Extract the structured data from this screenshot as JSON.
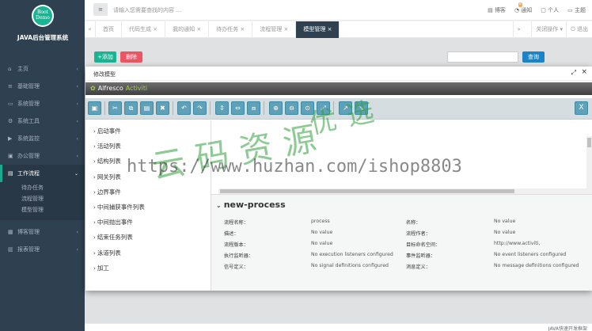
{
  "sidebar": {
    "logo_line1": "Boot",
    "logo_line2": "Demo",
    "app_title": "JAVA后台管理系统",
    "items": [
      {
        "icon": "home-icon",
        "glyph": "⌂",
        "label": "主页",
        "arrow": "‹"
      },
      {
        "icon": "list-icon",
        "glyph": "≡",
        "label": "基础管理",
        "arrow": "‹"
      },
      {
        "icon": "monitor-icon",
        "glyph": "▭",
        "label": "系统管理",
        "arrow": "‹"
      },
      {
        "icon": "gear-icon",
        "glyph": "⚙",
        "label": "系统工具",
        "arrow": "‹"
      },
      {
        "icon": "video-icon",
        "glyph": "▶",
        "label": "系统监控",
        "arrow": "‹"
      },
      {
        "icon": "briefcase-icon",
        "glyph": "▣",
        "label": "办公管理",
        "arrow": "‹"
      }
    ],
    "active_item": {
      "icon": "workflow-icon",
      "glyph": "▤",
      "label": "工作流程",
      "arrow": "⌄"
    },
    "sub_items": [
      "待办任务",
      "流程管理",
      "模型管理"
    ],
    "bottom_items": [
      {
        "icon": "blog-icon",
        "glyph": "▦",
        "label": "博客管理",
        "arrow": "‹"
      },
      {
        "icon": "report-icon",
        "glyph": "▥",
        "label": "报表管理",
        "arrow": "‹"
      }
    ]
  },
  "topbar": {
    "menu_glyph": "≡",
    "search_placeholder": "请输入您需要查找的内容 …",
    "right_items": [
      {
        "icon": "blog-icon",
        "glyph": "▤",
        "label": "博客"
      },
      {
        "icon": "bell-icon",
        "glyph": "🔔",
        "label": "通知",
        "badge": "8"
      },
      {
        "icon": "user-icon",
        "glyph": "▢",
        "label": "个人"
      },
      {
        "icon": "theme-icon",
        "glyph": "▭",
        "label": "主题"
      }
    ]
  },
  "tabs": {
    "prev": "«",
    "items": [
      "首页",
      "代码生成 ×",
      "我的通知 ×",
      "待办任务 ×",
      "流程管理 ×",
      "模型管理 ×"
    ],
    "active_index": 5,
    "next": "»",
    "ops": "关闭操作 ▾",
    "exit": "⏻ 退出"
  },
  "content": {
    "add_label": "+添加",
    "delete_label": "删除",
    "query_label": "查询"
  },
  "footer": {
    "text": "JAVA快速开发框架"
  },
  "modal": {
    "title": "修改模型",
    "max_glyph": "⤢",
    "close_glyph": "×",
    "brand1": "Alfresco",
    "brand2": "Activiti",
    "toolbar_icons": [
      {
        "name": "save-icon",
        "glyph": "▣"
      },
      {
        "name": "cut-icon",
        "glyph": "✂"
      },
      {
        "name": "copy-icon",
        "glyph": "⧉"
      },
      {
        "name": "paste-icon",
        "glyph": "▤"
      },
      {
        "name": "delete-icon",
        "glyph": "✖"
      },
      {
        "name": "undo-icon",
        "glyph": "↶"
      },
      {
        "name": "redo-icon",
        "glyph": "↷"
      },
      {
        "name": "align-vertical-icon",
        "glyph": "⇕"
      },
      {
        "name": "align-horizontal-icon",
        "glyph": "⇔"
      },
      {
        "name": "align-same-size-icon",
        "glyph": "⧈"
      },
      {
        "name": "zoom-in-icon",
        "glyph": "⊕"
      },
      {
        "name": "zoom-out-icon",
        "glyph": "⊖"
      },
      {
        "name": "zoom-actual-icon",
        "glyph": "⊙"
      },
      {
        "name": "zoom-fit-icon",
        "glyph": "⤢"
      },
      {
        "name": "bendpoint-add-icon",
        "glyph": "↗"
      },
      {
        "name": "bendpoint-remove-icon",
        "glyph": "↘"
      }
    ],
    "close_editor_glyph": "X",
    "palette": [
      "启动事件",
      "活动列表",
      "结构列表",
      "网关列表",
      "边界事件",
      "中间捕获事件列表",
      "中间抛出事件",
      "结束任务列表",
      "泳道列表",
      "加工"
    ],
    "props_title": "new-process",
    "props": [
      {
        "l": "流程名称：",
        "v": "process",
        "l2": "名称：",
        "v2": "No value"
      },
      {
        "l": "描述：",
        "v": "No value",
        "l2": "流程作者：",
        "v2": "No value"
      },
      {
        "l": "流程版本：",
        "v": "No value",
        "l2": "目标命名空间：",
        "v2": "http://www.activiti,"
      },
      {
        "l": "执行监听器：",
        "v": "No execution listeners configured",
        "l2": "事件监听器：",
        "v2": "No event listeners configured"
      },
      {
        "l": "信号定义：",
        "v": "No signal definitions configured",
        "l2": "消息定义：",
        "v2": "No message definitions configured"
      }
    ]
  },
  "watermark": {
    "url": "https://www.huzhan.com/ishop8803",
    "cn1": "云码资源",
    "cn2": "优选"
  },
  "colors": {
    "sidebar_bg": "#2f4050",
    "accent_green": "#1ab394",
    "danger": "#ed5565",
    "primary": "#1c84c6",
    "toolbar_btn": "#5ea1b8"
  }
}
